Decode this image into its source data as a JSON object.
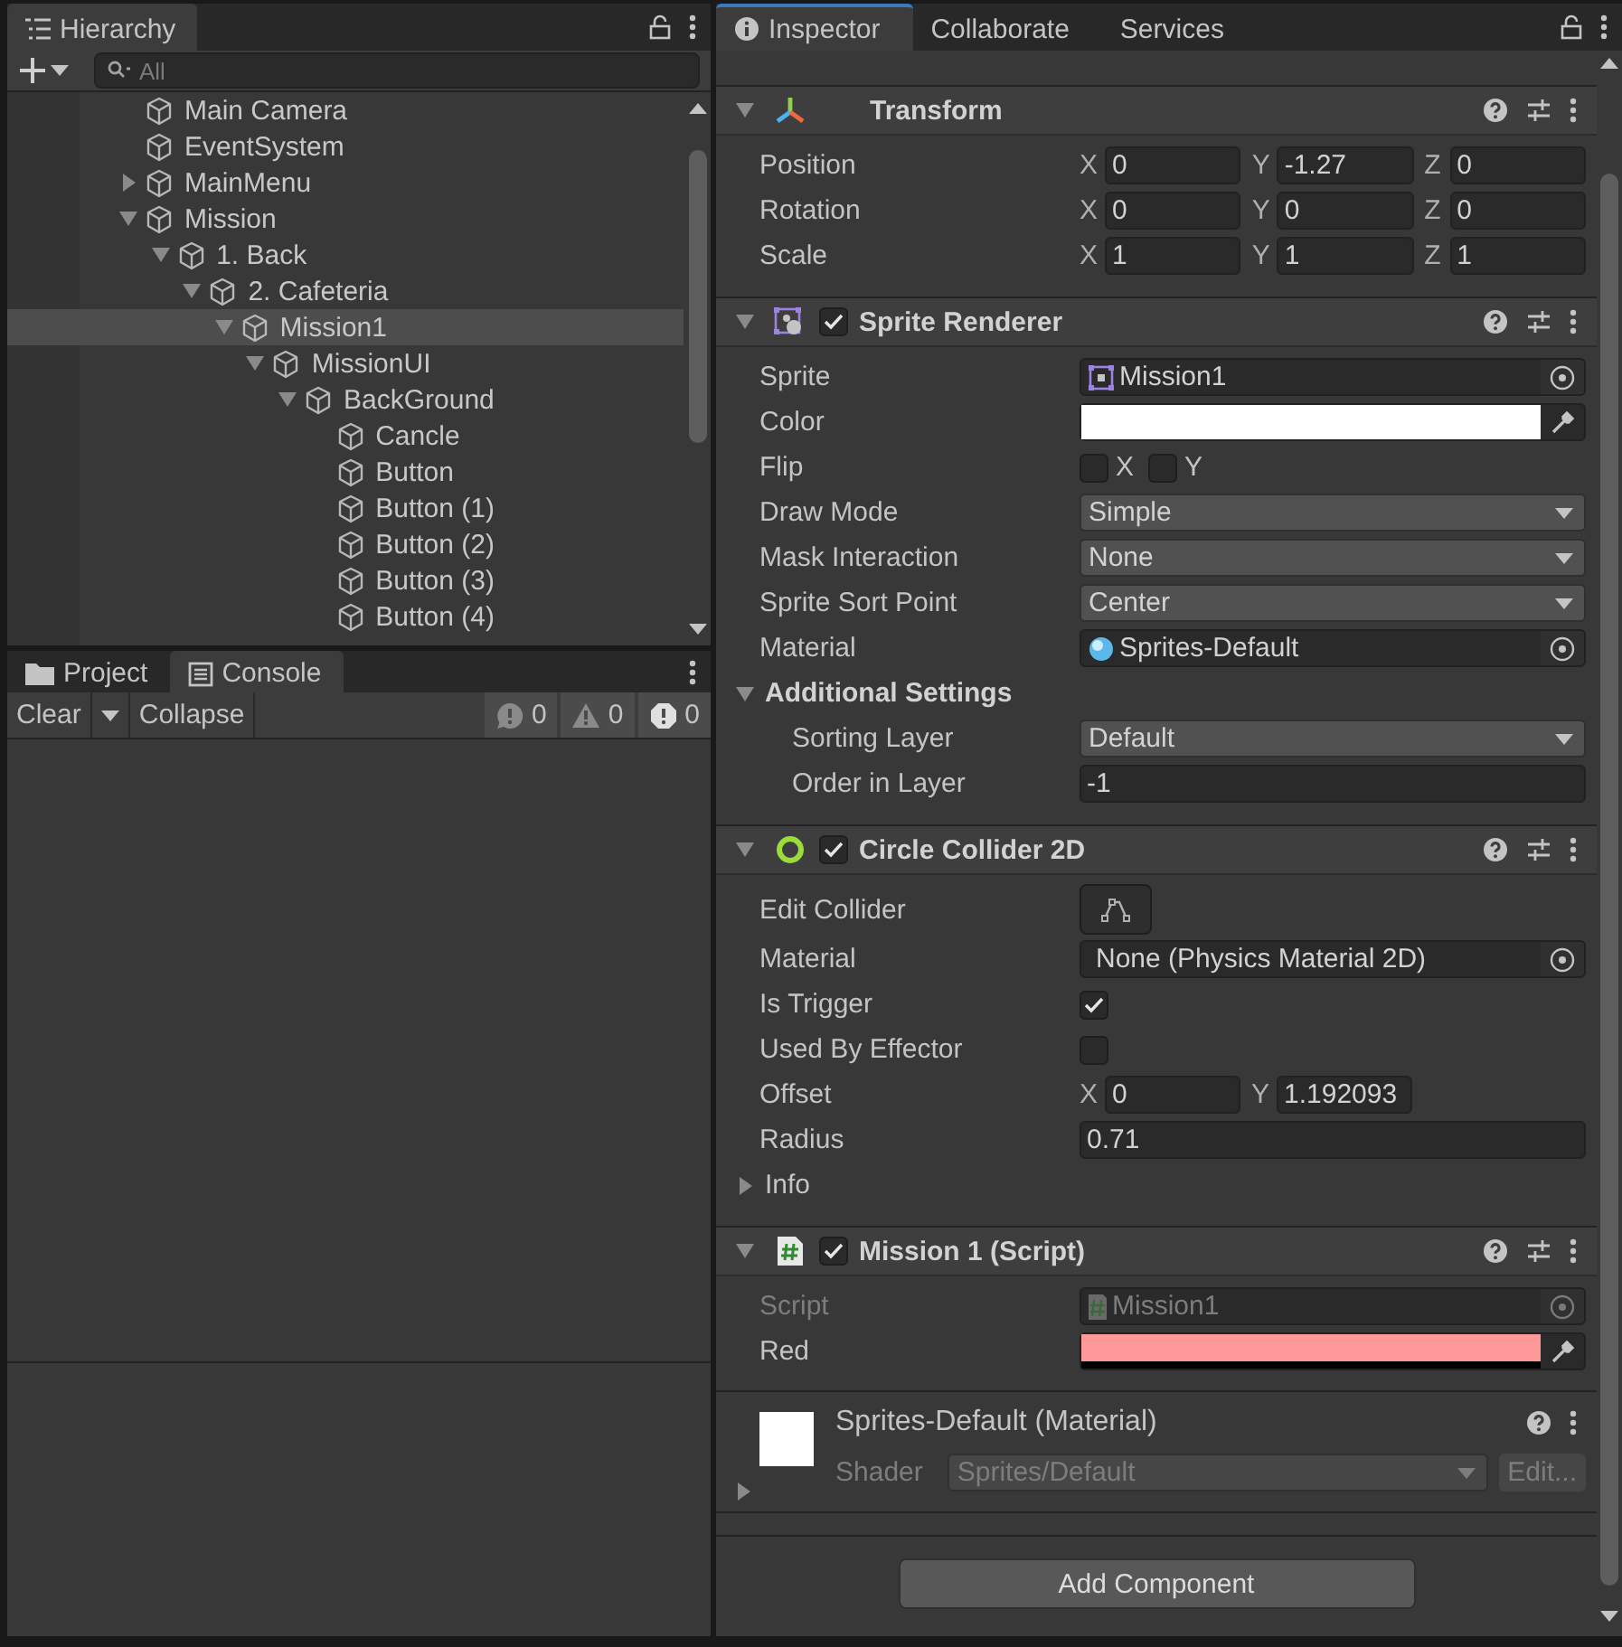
{
  "hierarchy": {
    "tab": {
      "label": "Hierarchy",
      "selected": true
    },
    "search": {
      "placeholder": "All"
    },
    "items": [
      {
        "label": "Main Camera",
        "selected": false
      },
      {
        "label": "EventSystem",
        "selected": false
      },
      {
        "label": "MainMenu",
        "selected": false,
        "expanded": false
      },
      {
        "label": "Mission",
        "selected": false,
        "expanded": true,
        "children": [
          {
            "label": "1. Back",
            "selected": false,
            "expanded": true,
            "children": [
              {
                "label": "2. Cafeteria",
                "selected": false,
                "expanded": true,
                "children": [
                  {
                    "label": "Mission1",
                    "selected": true,
                    "expanded": true,
                    "children": [
                      {
                        "label": "MissionUI",
                        "selected": false,
                        "expanded": true,
                        "children": [
                          {
                            "label": "BackGround",
                            "selected": false,
                            "expanded": true,
                            "children": [
                              {
                                "label": "Cancle",
                                "selected": false
                              },
                              {
                                "label": "Button",
                                "selected": false
                              },
                              {
                                "label": "Button (1)",
                                "selected": false
                              },
                              {
                                "label": "Button (2)",
                                "selected": false
                              },
                              {
                                "label": "Button (3)",
                                "selected": false
                              },
                              {
                                "label": "Button (4)",
                                "selected": false
                              }
                            ]
                          }
                        ]
                      }
                    ]
                  }
                ]
              }
            ]
          }
        ]
      }
    ]
  },
  "bottom_panel": {
    "tabs": [
      {
        "label": "Project",
        "kind": "project",
        "selected": false
      },
      {
        "label": "Console",
        "kind": "console",
        "selected": true
      }
    ],
    "toolbar": {
      "clear": "Clear",
      "collapse": "Collapse",
      "counts": [
        {
          "kind": "info",
          "count": "0"
        },
        {
          "kind": "warning",
          "count": "0"
        },
        {
          "kind": "error",
          "count": "0"
        }
      ]
    }
  },
  "inspector": {
    "tabs": [
      {
        "label": "Inspector",
        "selected": true
      },
      {
        "label": "Collaborate",
        "selected": false
      },
      {
        "label": "Services",
        "selected": false
      }
    ],
    "components": [
      {
        "title": "Transform",
        "kind": "transform",
        "expanded": true,
        "rows": [
          {
            "kind": "vector",
            "label": "Position",
            "fields": [
              {
                "axis": "X",
                "value": "0"
              },
              {
                "axis": "Y",
                "value": "-1.27"
              },
              {
                "axis": "Z",
                "value": "0"
              }
            ]
          },
          {
            "kind": "vector",
            "label": "Rotation",
            "fields": [
              {
                "axis": "X",
                "value": "0"
              },
              {
                "axis": "Y",
                "value": "0"
              },
              {
                "axis": "Z",
                "value": "0"
              }
            ]
          },
          {
            "kind": "vector",
            "label": "Scale",
            "fields": [
              {
                "axis": "X",
                "value": "1"
              },
              {
                "axis": "Y",
                "value": "1"
              },
              {
                "axis": "Z",
                "value": "1"
              }
            ]
          }
        ]
      },
      {
        "title": "Sprite Renderer",
        "kind": "sprite",
        "enabled": true,
        "expanded": true,
        "rows": [
          {
            "kind": "sprite",
            "label": "Sprite",
            "value": "Mission1"
          },
          {
            "kind": "color",
            "label": "Color",
            "color": "#ffffff"
          },
          {
            "kind": "flags",
            "label": "Flip",
            "options": [
              {
                "label": "X",
                "checked": false
              },
              {
                "label": "Y",
                "checked": false
              }
            ]
          },
          {
            "kind": "dropdown",
            "label": "Draw Mode",
            "value": "Simple"
          },
          {
            "kind": "dropdown",
            "label": "Mask Interaction",
            "value": "None"
          },
          {
            "kind": "dropdown",
            "label": "Sprite Sort Point",
            "value": "Center"
          },
          {
            "kind": "material",
            "label": "Material",
            "value": "Sprites-Default"
          },
          {
            "kind": "group",
            "label": "Additional Settings",
            "expanded": true,
            "children": [
              {
                "kind": "dropdown",
                "label": "Sorting Layer",
                "value": "Default"
              },
              {
                "kind": "field",
                "label": "Order in Layer",
                "value": "-1"
              }
            ]
          }
        ]
      },
      {
        "title": "Circle Collider 2D",
        "kind": "circle",
        "enabled": true,
        "expanded": true,
        "rows": [
          {
            "kind": "edit",
            "label": "Edit Collider"
          },
          {
            "kind": "reference",
            "label": "Material",
            "value": "None (Physics Material 2D)"
          },
          {
            "kind": "checkbox",
            "label": "Is Trigger",
            "checked": true
          },
          {
            "kind": "checkbox",
            "label": "Used By Effector",
            "checked": false
          },
          {
            "kind": "vector",
            "label": "Offset",
            "fields": [
              {
                "axis": "X",
                "value": "0"
              },
              {
                "axis": "Y",
                "value": "1.192093"
              }
            ]
          },
          {
            "kind": "field",
            "label": "Radius",
            "value": "0.71"
          },
          {
            "kind": "group",
            "label": "Info",
            "expanded": false
          }
        ]
      },
      {
        "title": "Mission 1 (Script)",
        "kind": "script",
        "enabled": true,
        "expanded": true,
        "rows": [
          {
            "kind": "script",
            "label": "Script",
            "value": "Mission1",
            "disabled": true
          },
          {
            "kind": "color",
            "label": "Red",
            "color": "#ff9999",
            "level": 0
          }
        ]
      }
    ],
    "material": {
      "title": "Sprites-Default (Material)",
      "shader_label": "Shader",
      "shader": "Sprites/Default",
      "edit": "Edit...",
      "expanded": false
    },
    "add_button": "Add Component"
  }
}
